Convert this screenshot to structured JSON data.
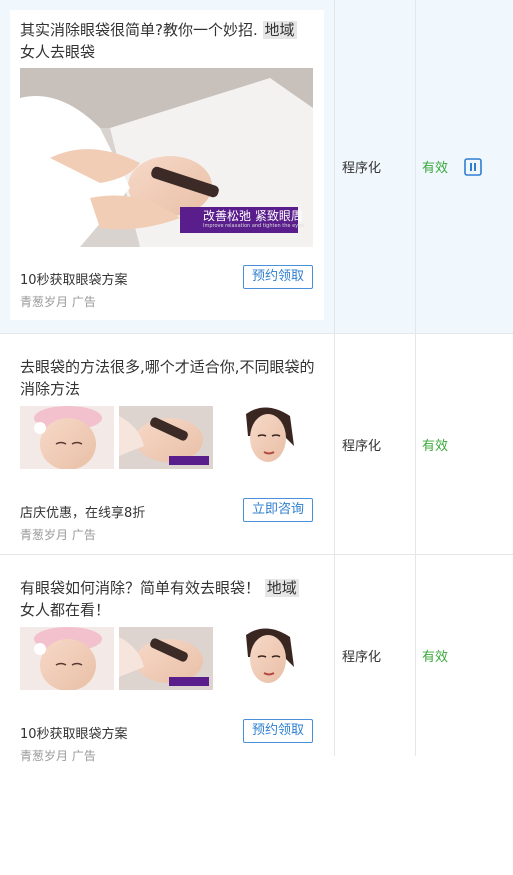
{
  "rows": [
    {
      "title": "其实消除眼袋很简单?教你一个妙招.",
      "tag": "地域",
      "title_cont": "女人去眼袋",
      "image_overlay": "改善松弛 紧致眼周",
      "image_overlay_sub": "Improve relaxation and tighten the eyes",
      "description": "10秒获取眼袋方案",
      "cta": "预约领取",
      "advertiser": "青葱岁月 广告",
      "type": "程序化",
      "status": "有效"
    },
    {
      "title": "去眼袋的方法很多,哪个才适合你,不同眼袋的消除方法",
      "description": "店庆优惠，在线享8折",
      "cta": "立即咨询",
      "advertiser": "青葱岁月 广告",
      "type": "程序化",
      "status": "有效"
    },
    {
      "title": "有眼袋如何消除？简单有效去眼袋！",
      "tag": "地域",
      "title_cont": "女人都在看！",
      "description": "10秒获取眼袋方案",
      "cta": "预约领取",
      "advertiser": "青葱岁月 广告",
      "type": "程序化",
      "status": "有效"
    }
  ],
  "colors": {
    "status_green": "#3aa83a",
    "link_blue": "#2f7fd0",
    "selected_row": "#f0f7fd"
  }
}
